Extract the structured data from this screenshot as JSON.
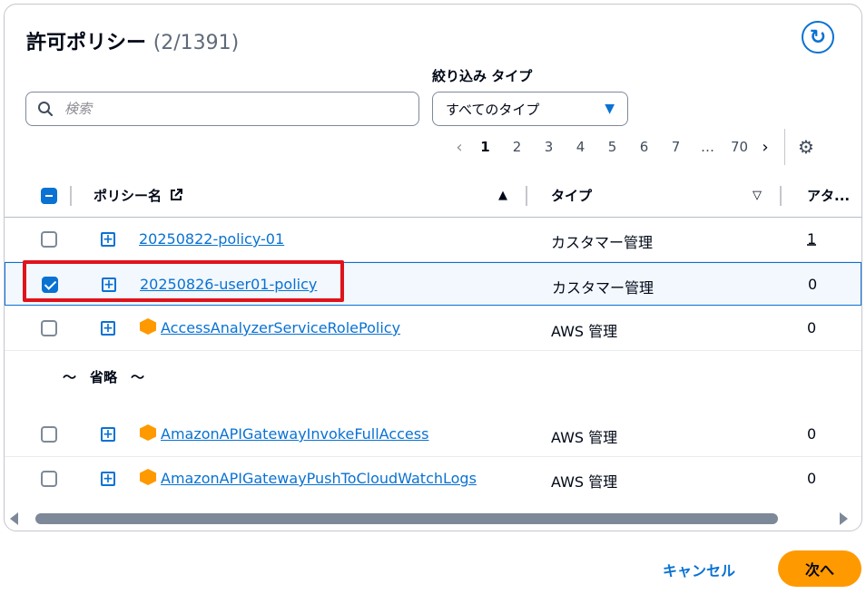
{
  "header": {
    "title": "許可ポリシー",
    "count": "(2/1391)"
  },
  "filter": {
    "search_placeholder": "検索",
    "type_label": "絞り込み タイプ",
    "type_value": "すべてのタイプ"
  },
  "pagination": {
    "prev": "‹",
    "pages": [
      "1",
      "2",
      "3",
      "4",
      "5",
      "6",
      "7",
      "…",
      "70"
    ],
    "current": "1",
    "next": "›"
  },
  "table": {
    "columns": {
      "name": "ポリシー名",
      "type": "タイプ",
      "attached": "アタ..."
    },
    "rows": [
      {
        "name": "20250822-policy-01",
        "type": "カスタマー管理",
        "attached": "1",
        "checked": false,
        "aws_icon": false
      },
      {
        "name": "20250826-user01-policy",
        "type": "カスタマー管理",
        "attached": "0",
        "checked": true,
        "aws_icon": false
      },
      {
        "name": "AccessAnalyzerServiceRolePolicy",
        "type": "AWS 管理",
        "attached": "0",
        "checked": false,
        "aws_icon": true
      },
      {
        "name": "AmazonAPIGatewayInvokeFullAccess",
        "type": "AWS 管理",
        "attached": "0",
        "checked": false,
        "aws_icon": true
      },
      {
        "name": "AmazonAPIGatewayPushToCloudWatchLogs",
        "type": "AWS 管理",
        "attached": "0",
        "checked": false,
        "aws_icon": true
      }
    ],
    "omitted_note": "～　省略　～"
  },
  "footer": {
    "cancel_label": "キャンセル",
    "next_label": "次へ"
  },
  "colors": {
    "link": "#0972d3",
    "primary_button": "#ff9900",
    "highlight": "#e0131d"
  }
}
